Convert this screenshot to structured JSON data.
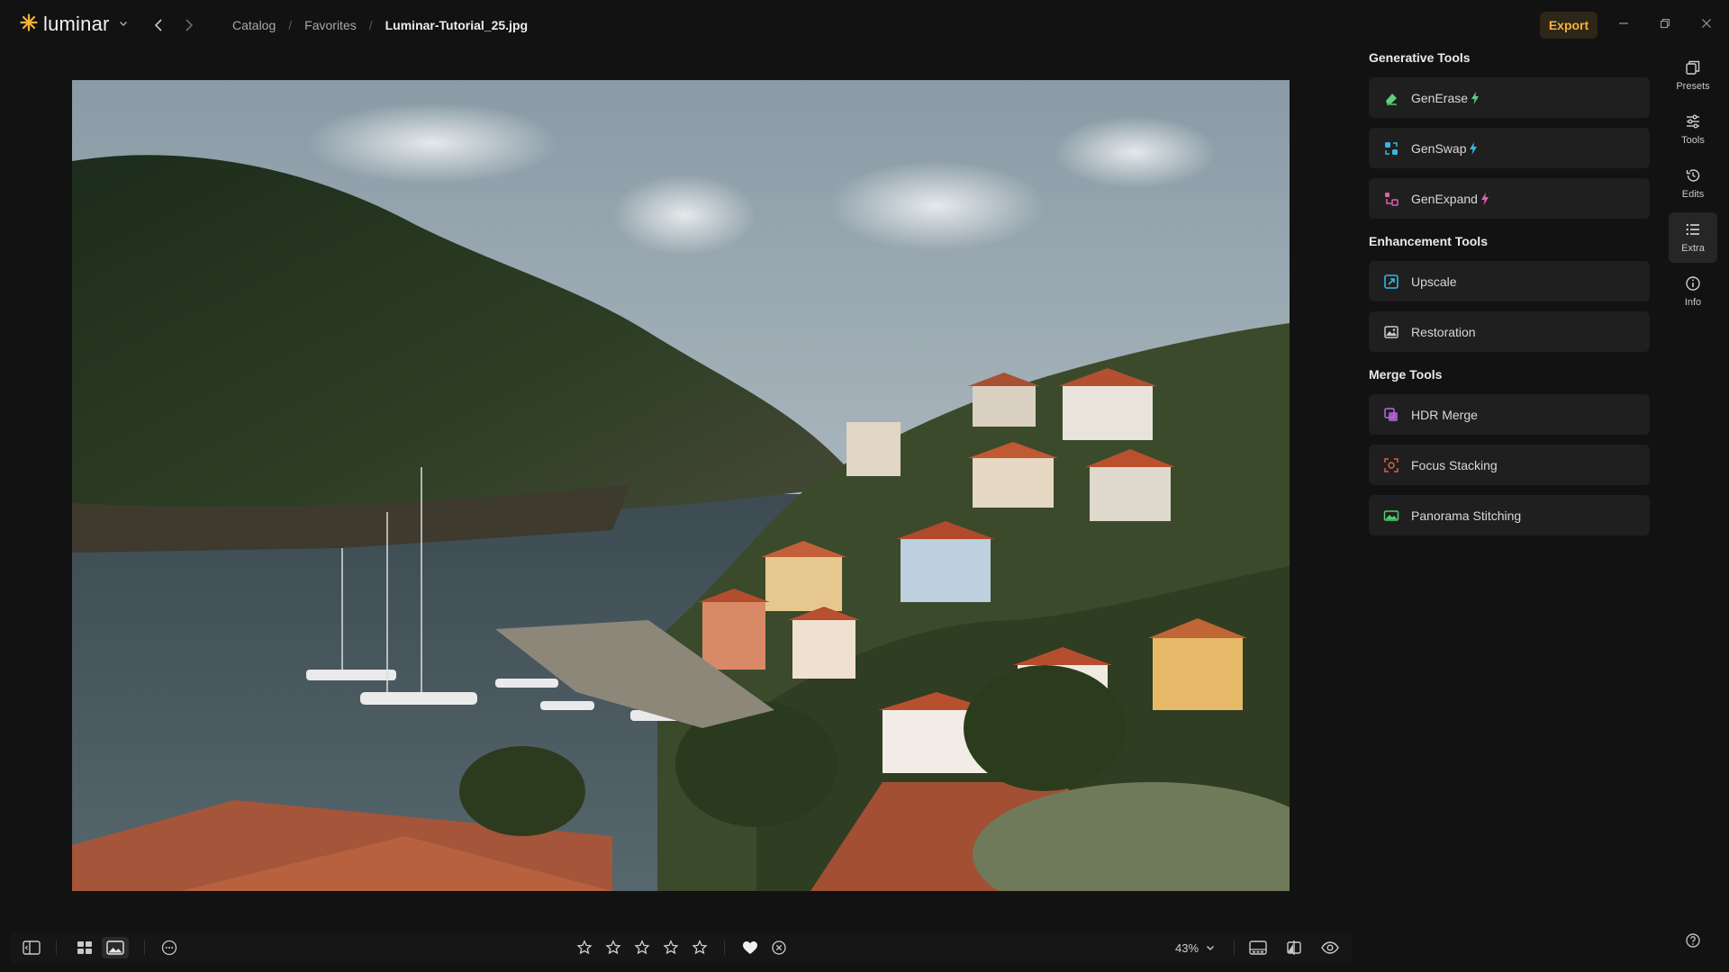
{
  "app": {
    "name": "luminar",
    "accent": "#f3b23a"
  },
  "breadcrumb": {
    "items": [
      "Catalog",
      "Favorites"
    ],
    "current": "Luminar-Tutorial_25.jpg"
  },
  "topbar": {
    "export_label": "Export"
  },
  "panel": {
    "sections": [
      {
        "title": "Generative Tools",
        "tools": [
          {
            "label": "GenErase",
            "icon": "eraser-icon",
            "bolt": true
          },
          {
            "label": "GenSwap",
            "icon": "swap-icon",
            "bolt": true
          },
          {
            "label": "GenExpand",
            "icon": "expand-icon",
            "bolt": true
          }
        ]
      },
      {
        "title": "Enhancement Tools",
        "tools": [
          {
            "label": "Upscale",
            "icon": "upscale-icon",
            "bolt": false
          },
          {
            "label": "Restoration",
            "icon": "restoration-icon",
            "bolt": false
          }
        ]
      },
      {
        "title": "Merge Tools",
        "tools": [
          {
            "label": "HDR Merge",
            "icon": "hdr-icon",
            "bolt": false
          },
          {
            "label": "Focus Stacking",
            "icon": "focus-icon",
            "bolt": false
          },
          {
            "label": "Panorama Stitching",
            "icon": "panorama-icon",
            "bolt": false
          }
        ]
      }
    ]
  },
  "rail": {
    "items": [
      {
        "label": "Presets",
        "icon": "presets-icon",
        "active": false
      },
      {
        "label": "Tools",
        "icon": "sliders-icon",
        "active": false
      },
      {
        "label": "Edits",
        "icon": "history-icon",
        "active": false
      },
      {
        "label": "Extra",
        "icon": "list-icon",
        "active": true
      },
      {
        "label": "Info",
        "icon": "info-icon",
        "active": false
      }
    ]
  },
  "bottombar": {
    "zoom": "43%",
    "rating_stars": 5,
    "rating_value": 0,
    "favorite": true
  }
}
